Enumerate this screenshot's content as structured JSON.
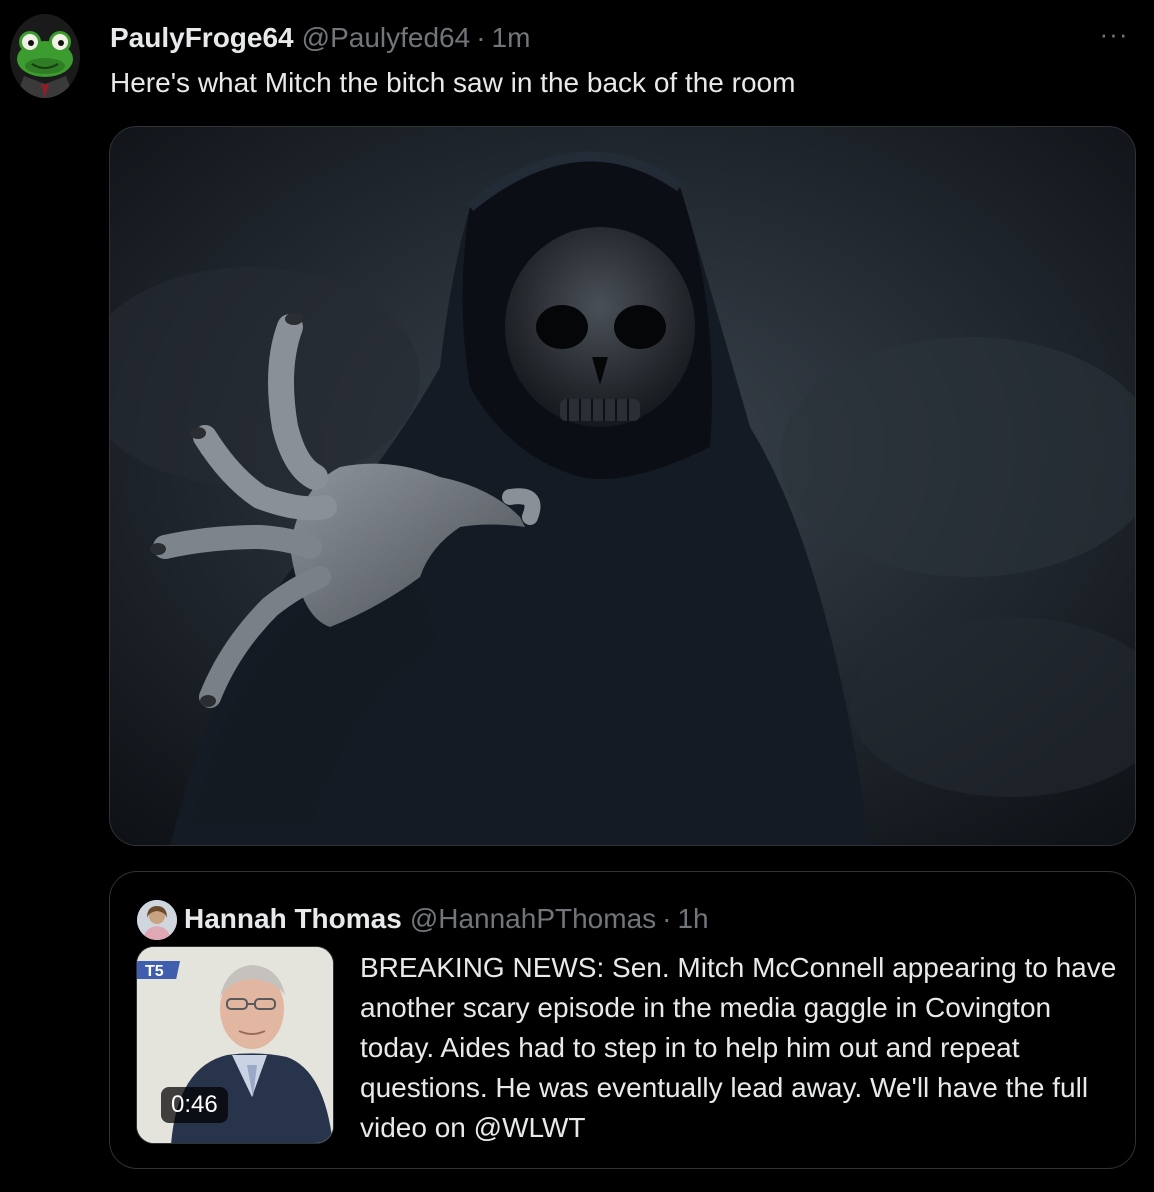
{
  "tweet": {
    "display_name": "PaulyFroge64",
    "handle": "@Paulyfed64",
    "separator": "·",
    "time": "1m",
    "more_label": "···",
    "text": "Here's what Mitch the bitch saw in the back of the room",
    "avatar_icon": "frog-avatar-icon",
    "media_icon": "grim-reaper-image"
  },
  "quote": {
    "display_name": "Hannah Thomas",
    "handle": "@HannahPThomas",
    "separator": "·",
    "time": "1h",
    "text": "BREAKING NEWS: Sen. Mitch McConnell appearing to have another scary episode in the media gaggle in Covington today. Aides had to step in to help him out and repeat questions. He was eventually lead away. We'll have the full video on @WLWT",
    "video_duration": "0:46",
    "thumb_logo_text": "T5",
    "colors": {
      "background": "#000000",
      "primary_text": "#e7e9ea",
      "secondary_text": "#71767b",
      "border": "#2f3336"
    }
  }
}
